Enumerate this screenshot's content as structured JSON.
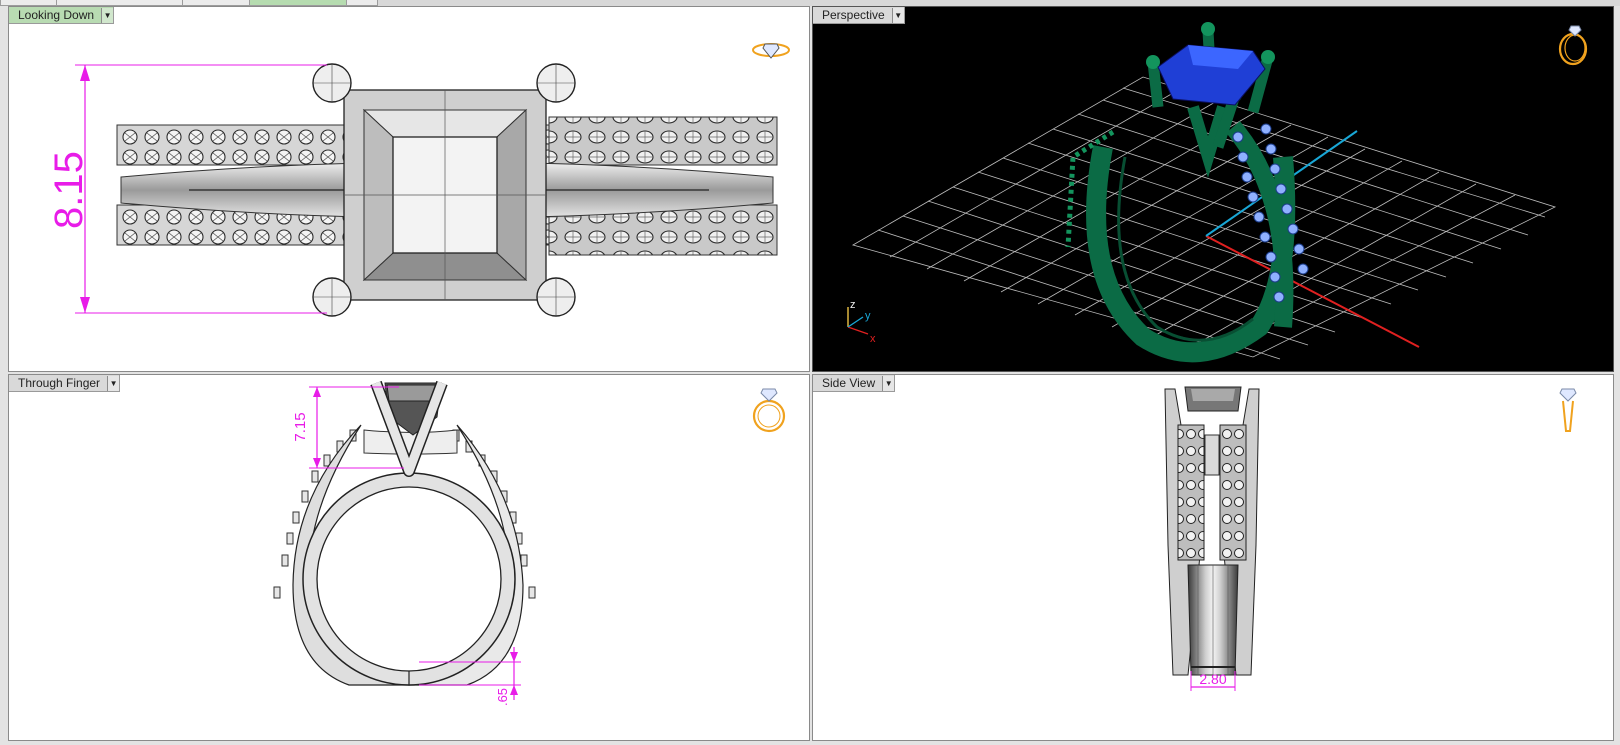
{
  "viewports": {
    "top_left": {
      "title": "Looking Down",
      "dimension": "8.15",
      "active": true
    },
    "top_right": {
      "title": "Perspective",
      "axes": {
        "z": "z",
        "y": "y",
        "x": "x"
      }
    },
    "bottom_left": {
      "title": "Through Finger",
      "dimension_top": "7.15",
      "dimension_bottom": ".65"
    },
    "bottom_right": {
      "title": "Side View",
      "dimension": "2.80"
    }
  },
  "icons": {
    "viewport_menu": "chevron-down-icon",
    "top_left_badge": "ring-top-icon",
    "top_right_badge": "ring-perspective-icon",
    "bottom_left_badge": "ring-front-icon",
    "bottom_right_badge": "ring-side-icon"
  },
  "colors": {
    "dimension": "#e81ce8",
    "badge": "#f0a21e",
    "ring_green": "#0b6b45",
    "gem_blue": "#1f3fd6",
    "stone_light_blue": "#8fb0ff",
    "grid": "#bfbfbf",
    "axis_x": "#e02020",
    "axis_y": "#19a7d6",
    "label_active": "#b8dbb2"
  }
}
